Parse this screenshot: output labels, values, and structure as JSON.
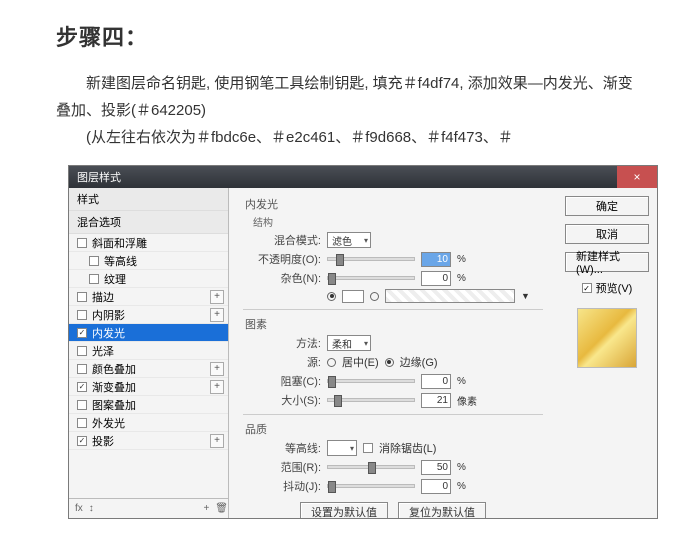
{
  "heading": "步骤四：",
  "para1": "新建图层命名钥匙, 使用钢笔工具绘制钥匙, 填充＃f4df74, 添加效果—内发光、渐变叠加、投影(＃642205)",
  "para2": "(从左往右依次为＃fbdc6e、＃e2c461、＃f9d668、＃f4f473、＃",
  "dialog": {
    "title": "图层样式",
    "close": "×",
    "left": {
      "header1": "样式",
      "header2": "混合选项",
      "items": [
        {
          "label": "斜面和浮雕",
          "checked": false,
          "plus": false
        },
        {
          "label": "等高线",
          "checked": false,
          "indent": true
        },
        {
          "label": "纹理",
          "checked": false,
          "indent": true
        },
        {
          "label": "描边",
          "checked": false,
          "plus": true
        },
        {
          "label": "内阴影",
          "checked": false,
          "plus": true
        },
        {
          "label": "内发光",
          "checked": true,
          "selected": true
        },
        {
          "label": "光泽",
          "checked": false
        },
        {
          "label": "颜色叠加",
          "checked": false,
          "plus": true
        },
        {
          "label": "渐变叠加",
          "checked": true,
          "plus": true
        },
        {
          "label": "图案叠加",
          "checked": false
        },
        {
          "label": "外发光",
          "checked": false
        },
        {
          "label": "投影",
          "checked": true,
          "plus": true
        }
      ],
      "foot": "fx"
    },
    "mid": {
      "group1": "内发光",
      "sub1": "结构",
      "blend_label": "混合模式:",
      "blend_value": "滤色",
      "opacity_label": "不透明度(O):",
      "opacity_value": "10",
      "noise_label": "杂色(N):",
      "noise_value": "0",
      "group2": "图素",
      "method_label": "方法:",
      "method_value": "柔和",
      "source_label": "源:",
      "source_center": "居中(E)",
      "source_edge": "边缘(G)",
      "choke_label": "阻塞(C):",
      "choke_value": "0",
      "size_label": "大小(S):",
      "size_value": "21",
      "size_unit": "像素",
      "group3": "品质",
      "contour_label": "等高线:",
      "anti_label": "消除锯齿(L)",
      "range_label": "范围(R):",
      "range_value": "50",
      "jitter_label": "抖动(J):",
      "jitter_value": "0",
      "btn_default": "设置为默认值",
      "btn_reset": "复位为默认值",
      "pct": "%"
    },
    "right": {
      "ok": "确定",
      "cancel": "取消",
      "newstyle": "新建样式(W)...",
      "preview_label": "预览(V)"
    }
  }
}
